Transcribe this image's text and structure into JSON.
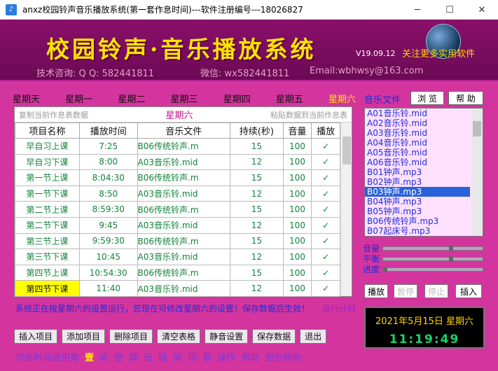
{
  "window": {
    "title": "anxz校园铃声音乐播放系统(第一套作息时间)---软件注册编号---18026827",
    "min": "─",
    "max": "☐",
    "close": "✕"
  },
  "banner": {
    "title": "校园铃声·音乐播放系统",
    "version": "V19.09.12",
    "link": "关注更多实用软件",
    "contact_qq": "技术咨询: Q Q: 582441811",
    "contact_wx": "微信: wx582441811",
    "contact_email": "Email:wbhwsy@163.com"
  },
  "weekdays": [
    "星期天",
    "星期一",
    "星期二",
    "星期三",
    "星期四",
    "星期五",
    "星期六"
  ],
  "active_day_index": 6,
  "grid": {
    "copy_label": "复制当前作息表数据",
    "day_label": "星期六",
    "paste_label": "粘贴数据到当前作息表",
    "headers": [
      "项目名称",
      "播放时间",
      "音乐文件",
      "持续(秒)",
      "音量",
      "播放"
    ],
    "rows": [
      [
        "早自习上课",
        "7:25",
        "B06传统铃声.m",
        "15",
        "100",
        "✓"
      ],
      [
        "早自习下课",
        "8:00",
        "A03音乐铃.mid",
        "12",
        "100",
        "✓"
      ],
      [
        "第一节上课",
        "8:04:30",
        "B06传统铃声.m",
        "15",
        "100",
        "✓"
      ],
      [
        "第一节下课",
        "8:50",
        "A03音乐铃.mid",
        "12",
        "100",
        "✓"
      ],
      [
        "第二节上课",
        "8:59:30",
        "B06传统铃声.m",
        "15",
        "100",
        "✓"
      ],
      [
        "第二节下课",
        "9:45",
        "A03音乐铃.mid",
        "12",
        "100",
        "✓"
      ],
      [
        "第三节上课",
        "9:59:30",
        "B06传统铃声.m",
        "15",
        "100",
        "✓"
      ],
      [
        "第三节下课",
        "10:45",
        "A03音乐铃.mid",
        "12",
        "100",
        "✓"
      ],
      [
        "第四节上课",
        "10:54:30",
        "B06传统铃声.m",
        "15",
        "100",
        "✓"
      ],
      [
        "第四节下课",
        "11:40",
        "A03音乐铃.mid",
        "12",
        "100",
        "✓"
      ]
    ]
  },
  "status_text": "系统正在按星期六的设置运行，您现在可修改星期六的设置！保存数据后生效！",
  "status_right": "运行计时",
  "actions": [
    "插入项目",
    "添加项目",
    "删除项目",
    "清空表格",
    "静音设置",
    "保存数据",
    "退出"
  ],
  "period": {
    "label": "作息时间选用第",
    "options": [
      "壹",
      "贰",
      "叁",
      "肆",
      "伍",
      "陆",
      "柒",
      "捌",
      "套"
    ],
    "extra": [
      "操作",
      "帮助",
      "图形帮助"
    ]
  },
  "music": {
    "label": "音乐文件",
    "browse": "浏 览",
    "help": "帮 助",
    "files": [
      "A01音乐铃.mid",
      "A02音乐铃.mid",
      "A03音乐铃.mid",
      "A04音乐铃.mid",
      "A05音乐铃.mid",
      "A06音乐铃.mid",
      "B01钟声.mp3",
      "B02钟声.mp3",
      "B03钟声.mp3",
      "B04钟声.mp3",
      "B05钟声.mp3",
      "B06传统铃声.mp3",
      "B07起床号.mp3"
    ],
    "selected_index": 8
  },
  "sliders": [
    {
      "label": "音量",
      "value": 0.68
    },
    {
      "label": "平衡",
      "value": 0.68
    },
    {
      "label": "进度",
      "value": 0.0
    }
  ],
  "playback": {
    "play": "播放",
    "pause": "暂停",
    "stop": "停止",
    "insert": "插入"
  },
  "clock": {
    "date": "2021年5月15日  星期六",
    "time": "11:19:49"
  }
}
